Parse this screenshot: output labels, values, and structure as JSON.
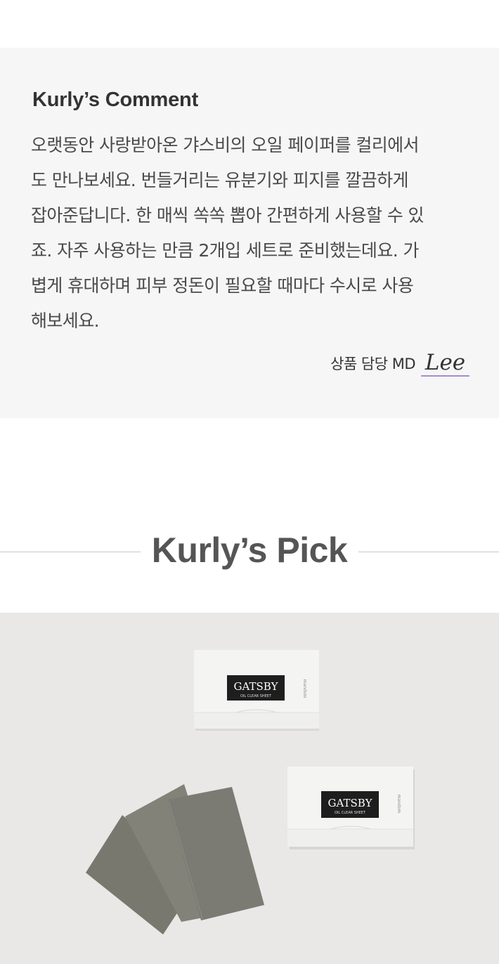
{
  "comment": {
    "title": "Kurly’s Comment",
    "lines": [
      "오랫동안 사랑받아온 갸스비의 오일 페이퍼를 컬리에서",
      "도 만나보세요. 번들거리는 유분기와 피지를 깔끔하게",
      "잡아준답니다. 한 매씩 쏙쏙 뽑아 간편하게 사용할 수 있",
      "죠. 자주 사용하는 만큼 2개입 세트로 준비했는데요. 가",
      "볍게 휴대하며 피부 정돈이 필요할 때마다 수시로 사용",
      "해보세요."
    ],
    "signature_role": "상품 담당 MD",
    "signature_name": "Lee"
  },
  "pick": {
    "title": "Kurly’s Pick"
  },
  "product_image": {
    "brand_label": "GATSBY",
    "sub_label": "OIL CLEAR SHEET",
    "side_label": "mandom",
    "colors": {
      "background": "#e9e8e6",
      "package": "#f4f4f2",
      "label": "#1e1e1e",
      "sheet": "#7f7f77"
    }
  }
}
